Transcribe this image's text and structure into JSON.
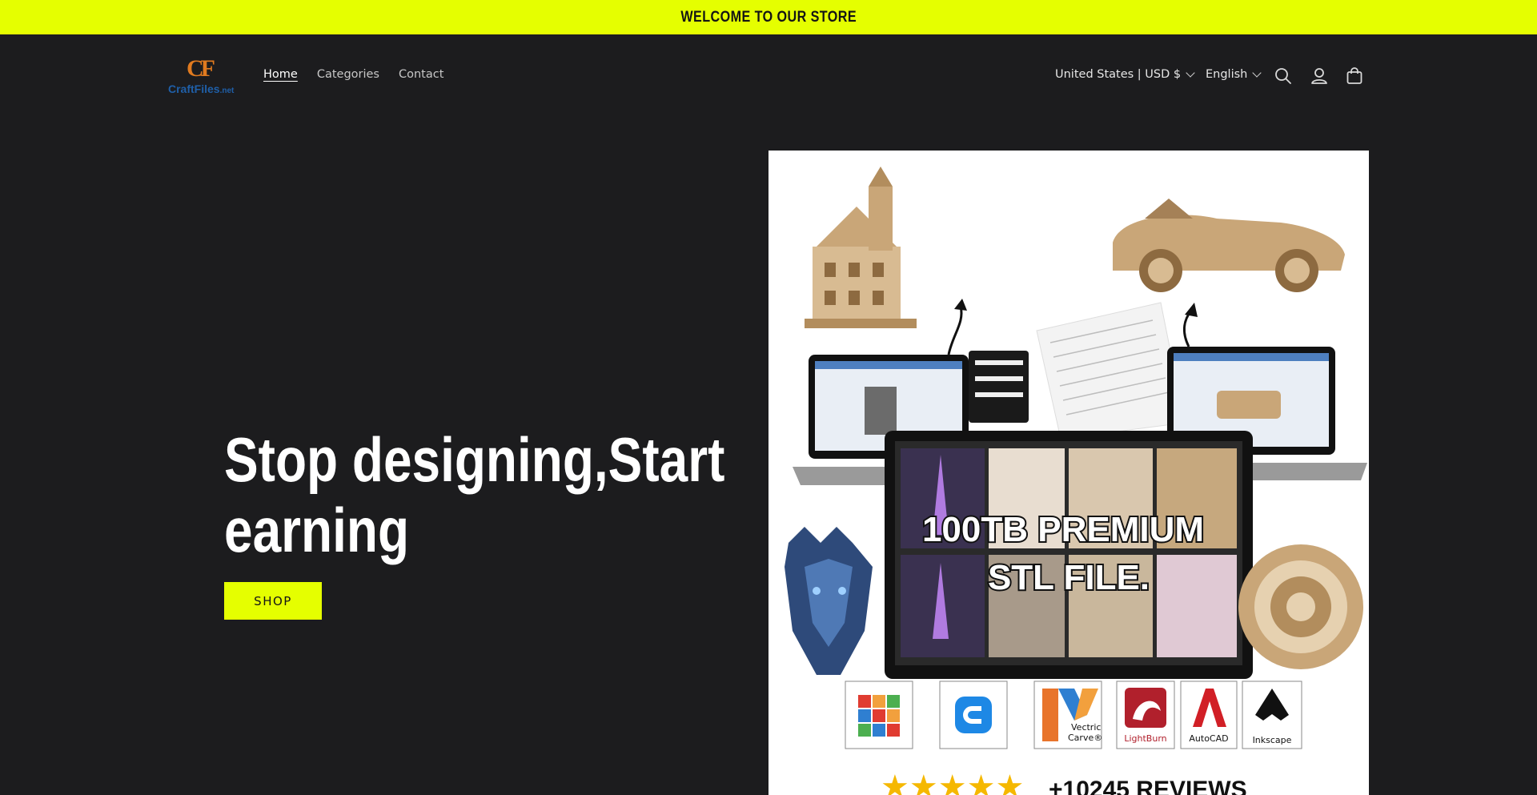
{
  "announcement": {
    "text": "WELCOME TO OUR STORE"
  },
  "brand": {
    "logo_mark": "CF",
    "logo_word": "CraftFiles",
    "logo_suffix": ".net"
  },
  "nav": {
    "items": [
      {
        "label": "Home",
        "active": true
      },
      {
        "label": "Categories",
        "active": false
      },
      {
        "label": "Contact",
        "active": false
      }
    ]
  },
  "locale": {
    "country_currency": "United States | USD $",
    "language": "English"
  },
  "icons": {
    "search": "search-icon",
    "account": "account-icon",
    "cart": "cart-icon",
    "chevron": "chevron-down-icon"
  },
  "hero": {
    "title": "Stop designing,Start earning",
    "cta_label": "SHOP"
  },
  "promo": {
    "headline_line1": "100TB PREMIUM",
    "headline_line2": "STL FILE.",
    "software": [
      "TINKERCAD",
      "",
      "Vectric Carve",
      "LightBurn",
      "AutoCAD",
      "Inkscape"
    ],
    "vectric_label_1": "Vectric",
    "vectric_label_2": "Carve®",
    "reviews": "+10245 REVIEWS",
    "stars": 5
  },
  "colors": {
    "accent": "#e5ff00",
    "background": "#1c1c1e",
    "promo_bg": "#ffffff"
  }
}
